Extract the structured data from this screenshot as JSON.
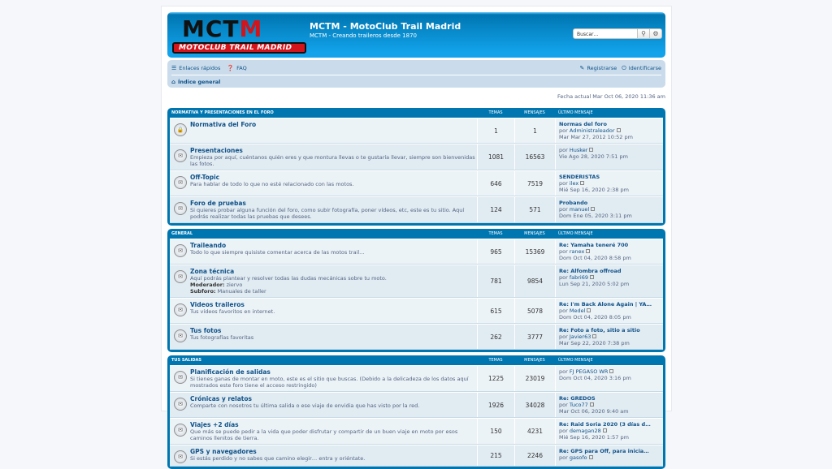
{
  "header": {
    "logo_text": "MCTM",
    "logo_ribbon": "MOTOCLUB TRAIL MADRID",
    "site_title": "MCTM - MotoClub Trail Madrid",
    "site_desc": "MCTM - Creando traileros desde 1870",
    "search_placeholder": "Buscar…"
  },
  "nav": {
    "quick_links": "Enlaces rápidos",
    "faq": "FAQ",
    "register": "Registrarse",
    "login": "Identificarse",
    "breadcrumb": "Índice general"
  },
  "current_time": "Fecha actual Mar Oct 06, 2020 11:36 am",
  "columns": {
    "topics": "TEMAS",
    "posts": "MENSAJES",
    "last": "ÚLTIMO MENSAJE"
  },
  "sections": [
    {
      "title": "NORMATIVA Y PRESENTACIONES EN EL FORO",
      "forums": [
        {
          "name": "Normativa del Foro",
          "desc": "",
          "topics": "1",
          "posts": "1",
          "last_title": "Normas del foro",
          "last_by": "por",
          "last_author": "Administraleador",
          "last_date": "Mar Mar 27, 2012 10:52 pm",
          "locked": true
        },
        {
          "name": "Presentaciones",
          "desc": "Empieza por aquí, cuéntanos quién eres y que montura llevas o te gustaría llevar, siempre son bienvenidas las fotos.",
          "topics": "1081",
          "posts": "16563",
          "last_title": "",
          "last_by": "por",
          "last_author": "Husker",
          "last_date": "Vie Ago 28, 2020 7:51 pm"
        },
        {
          "name": "Off-Topic",
          "desc": "Para hablar de todo lo que no esté relacionado con las motos.",
          "topics": "646",
          "posts": "7519",
          "last_title": "SENDERISTAS",
          "last_by": "por",
          "last_author": "ilex",
          "last_date": "Mié Sep 16, 2020 2:38 pm"
        },
        {
          "name": "Foro de pruebas",
          "desc": "Si quieres probar alguna función del foro, como subir fotografía, poner vídeos, etc, este es tu sitio. Aquí podrás realizar todas las pruebas que desees.",
          "topics": "124",
          "posts": "571",
          "last_title": "Probando",
          "last_by": "por",
          "last_author": "manuel",
          "last_date": "Dom Ene 05, 2020 3:11 pm"
        }
      ]
    },
    {
      "title": "GENERAL",
      "forums": [
        {
          "name": "Traileando",
          "desc": "Todo lo que siempre quisiste comentar acerca de las motos trail…",
          "topics": "965",
          "posts": "15369",
          "last_title": "Re: Yamaha teneré 700",
          "last_by": "por",
          "last_author": "ranex",
          "last_date": "Dom Oct 04, 2020 8:58 pm"
        },
        {
          "name": "Zona técnica",
          "desc": "Aquí podrás plantear y resolver todas las dudas mecánicas sobre tu moto.",
          "mod_label": "Moderador:",
          "mod_name": "ziervo",
          "sub_label": "Subforo:",
          "sub_name": "Manuales de taller",
          "topics": "781",
          "posts": "9854",
          "last_title": "Re: Alfombra offroad",
          "last_by": "por",
          "last_author": "fabri69",
          "last_date": "Lun Sep 21, 2020 5:02 pm"
        },
        {
          "name": "Videos traileros",
          "desc": "Tus vídeos favoritos en internet.",
          "topics": "615",
          "posts": "5078",
          "last_title": "Re: I'm Back Alone Again | YA…",
          "last_by": "por",
          "last_author": "Medel",
          "last_date": "Dom Oct 04, 2020 8:05 pm"
        },
        {
          "name": "Tus fotos",
          "desc": "Tus fotografías favoritas",
          "topics": "262",
          "posts": "3777",
          "last_title": "Re: Foto a foto, sitio a sitio",
          "last_by": "por",
          "last_author": "Javier63",
          "last_date": "Mar Sep 22, 2020 7:38 pm"
        }
      ]
    },
    {
      "title": "TUS SALIDAS",
      "forums": [
        {
          "name": "Planificación de salidas",
          "desc": "Si tienes ganas de montar en moto, este es el sitio que buscas. (Debido a la delicadeza de los datos aquí mostrados este foro tiene el acceso restringido)",
          "topics": "1225",
          "posts": "23019",
          "last_title": "",
          "last_by": "por",
          "last_author": "FJ PEGASO WR",
          "last_date": "Dom Oct 04, 2020 3:16 pm"
        },
        {
          "name": "Crónicas y relatos",
          "desc": "Comparte con nosotros tu última salida o ese viaje de envidia que has visto por la red.",
          "topics": "1926",
          "posts": "34028",
          "last_title": "Re: GREDOS",
          "last_by": "por",
          "last_author": "Tuco77",
          "last_date": "Mar Oct 06, 2020 9:40 am"
        },
        {
          "name": "Viajes +2 días",
          "desc": "Que más se puede pedir a la vida que poder disfrutar y compartir de un buen viaje en moto por esos caminos llenitos de tierra.",
          "topics": "150",
          "posts": "4231",
          "last_title": "Re: Raid Soria 2020 (3 días d…",
          "last_by": "por",
          "last_author": "demagan28",
          "last_date": "Mié Sep 16, 2020 1:57 pm"
        },
        {
          "name": "GPS y navegadores",
          "desc": "Si estás perdido y no sabes que camino elegir… entra y oriéntate.",
          "topics": "215",
          "posts": "2246",
          "last_title": "Re: GPS para Off, para inicia…",
          "last_by": "por",
          "last_author": "gasofo",
          "last_date": ""
        }
      ]
    }
  ]
}
